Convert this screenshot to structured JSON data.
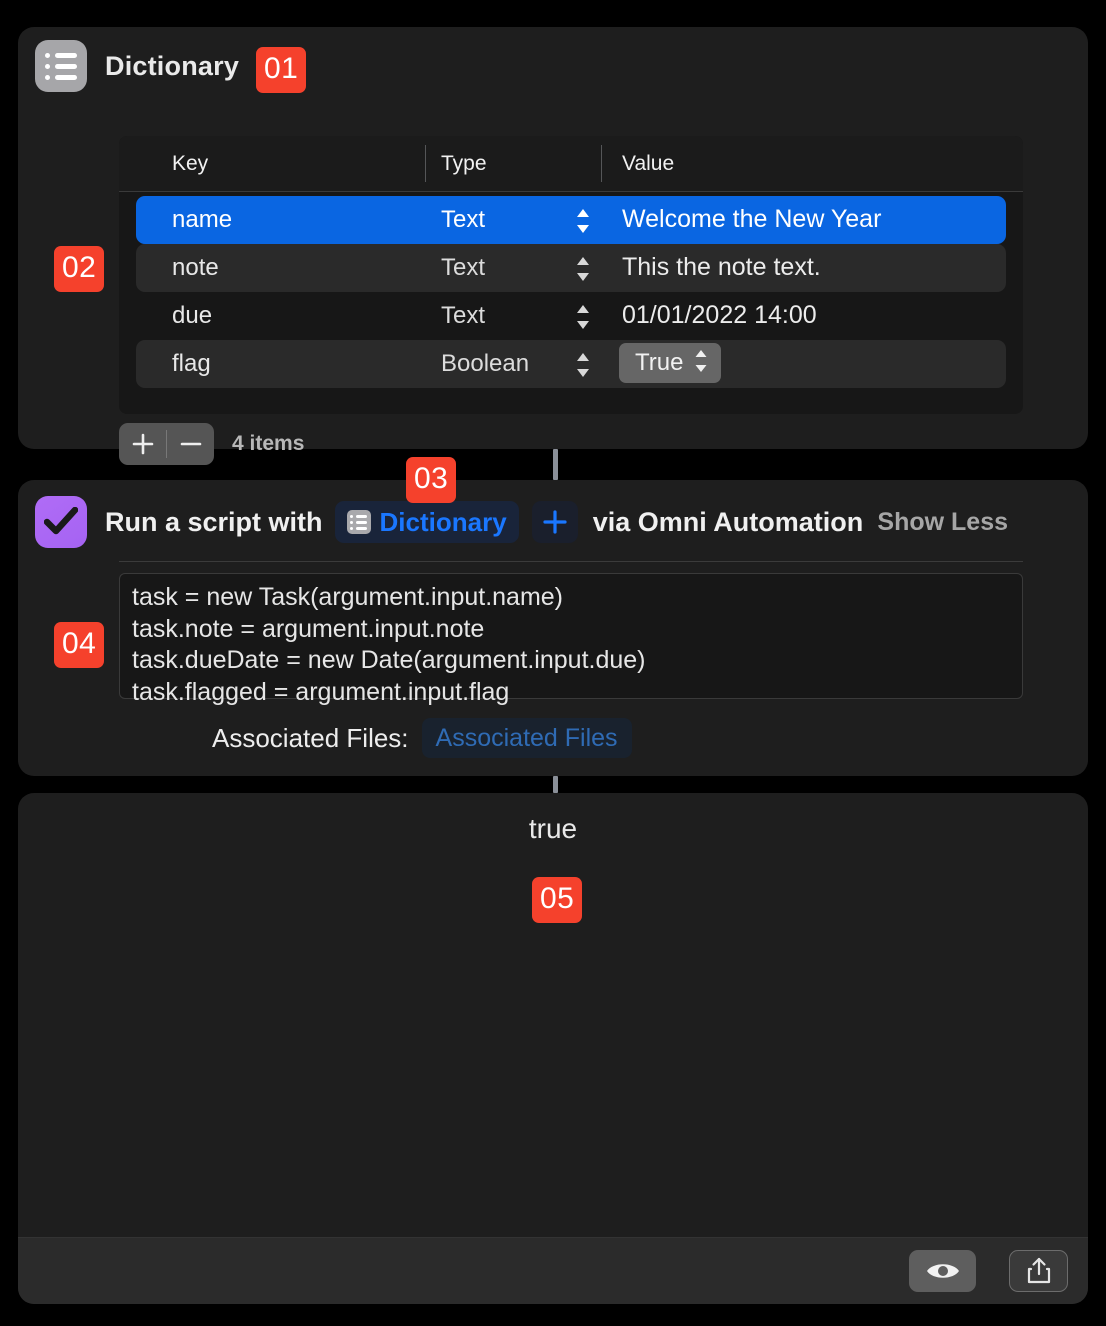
{
  "dictionary_card": {
    "icon": "list-icon",
    "title": "Dictionary",
    "badge": "01",
    "table_badge": "02",
    "columns": [
      "Key",
      "Type",
      "Value"
    ],
    "rows": [
      {
        "key": "name",
        "type": "Text",
        "value": "Welcome the New Year",
        "selected": true,
        "value_kind": "text"
      },
      {
        "key": "note",
        "type": "Text",
        "value": "This the note text.",
        "selected": false,
        "value_kind": "text"
      },
      {
        "key": "due",
        "type": "Text",
        "value": "01/01/2022 14:00",
        "selected": false,
        "value_kind": "text"
      },
      {
        "key": "flag",
        "type": "Boolean",
        "value": "True",
        "selected": false,
        "value_kind": "popup"
      }
    ],
    "add_button": "+",
    "remove_button": "−",
    "items_count": "4 items"
  },
  "script_card": {
    "icon": "omnifocus-checkmark-icon",
    "badge": "03",
    "code_badge": "04",
    "label_prefix": "Run a script with",
    "token_label": "Dictionary",
    "token_icon": "list-icon",
    "add_variable_button": "+",
    "label_suffix": "via Omni Automation",
    "show_less": "Show Less",
    "script_lines": [
      "task = new Task(argument.input.name)",
      "task.note = argument.input.note",
      "task.dueDate = new Date(argument.input.due)",
      "task.flagged = argument.input.flag"
    ],
    "associated_files_label": "Associated Files:",
    "associated_files_placeholder": "Associated Files"
  },
  "result_card": {
    "result": "true",
    "badge": "05",
    "preview_button": "eye-icon",
    "share_button": "share-icon"
  },
  "colors": {
    "badge": "#f5412c",
    "selection": "#0a66e2",
    "token_blue": "#1a77ff",
    "omnifocus_purple": "#a563f2",
    "card_background": "#1e1e1e"
  }
}
